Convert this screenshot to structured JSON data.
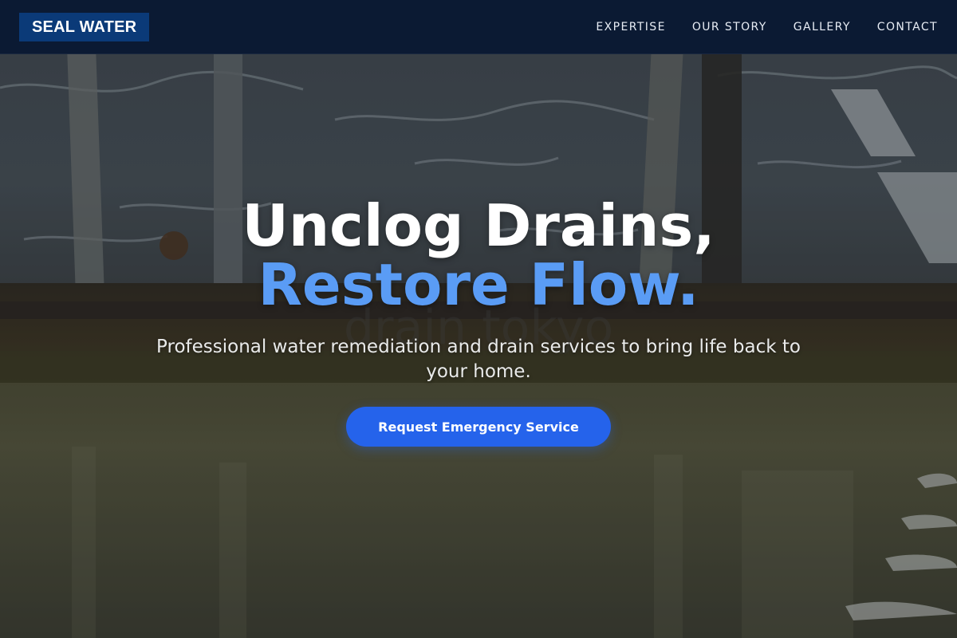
{
  "brand": {
    "name": "SEAL WATER",
    "color": "#0b3a78"
  },
  "nav": {
    "items": [
      {
        "label": "EXPERTISE"
      },
      {
        "label": "OUR STORY"
      },
      {
        "label": "GALLERY"
      },
      {
        "label": "CONTACT"
      }
    ]
  },
  "hero": {
    "headline_line1": "Unclog Drains,",
    "headline_line2": "Restore Flow.",
    "subtitle": "Professional water remediation and drain services to bring life back to your home.",
    "cta_label": "Request Emergency Service",
    "background_watermark": "drain tokyo",
    "accent_color": "#5a9cf5",
    "button_color": "#2563eb"
  }
}
